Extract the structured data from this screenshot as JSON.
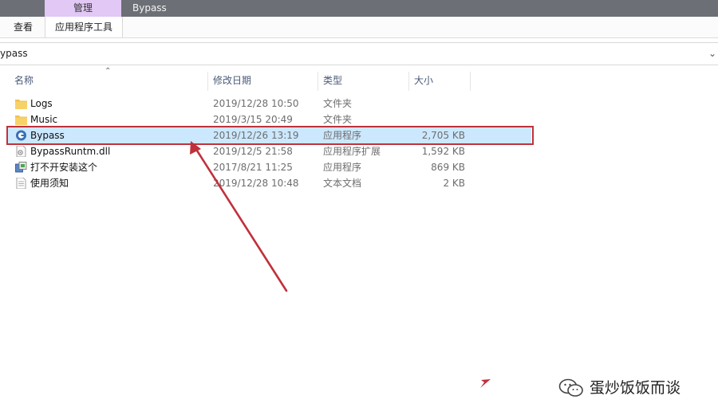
{
  "ribbon": {
    "context_tab": "管理",
    "window_title": "Bypass",
    "tabs": [
      "查看",
      "应用程序工具"
    ]
  },
  "address_bar": {
    "path": "ypass",
    "chevron": "⌄"
  },
  "columns": {
    "name": "名称",
    "date": "修改日期",
    "type": "类型",
    "size": "大小"
  },
  "files": [
    {
      "name": "Logs",
      "date": "2019/12/28 10:50",
      "type": "文件夹",
      "size": "",
      "icon": "folder-icon"
    },
    {
      "name": "Music",
      "date": "2019/3/15 20:49",
      "type": "文件夹",
      "size": "",
      "icon": "folder-icon"
    },
    {
      "name": "Bypass",
      "date": "2019/12/26 13:19",
      "type": "应用程序",
      "size": "2,705 KB",
      "icon": "app-icon",
      "selected": true
    },
    {
      "name": "BypassRuntm.dll",
      "date": "2019/12/5 21:58",
      "type": "应用程序扩展",
      "size": "1,592 KB",
      "icon": "dll-icon"
    },
    {
      "name": "打不开安装这个",
      "date": "2017/8/21 11:25",
      "type": "应用程序",
      "size": "869 KB",
      "icon": "installer-icon"
    },
    {
      "name": "使用须知",
      "date": "2019/12/28 10:48",
      "type": "文本文档",
      "size": "2 KB",
      "icon": "text-file-icon"
    }
  ],
  "watermark": {
    "text": "蛋炒饭饭而谈",
    "icon": "wechat-icon"
  },
  "colors": {
    "selection": "#cce8ff",
    "highlight": "#c0313b",
    "context_tab": "#e2c8f5",
    "title_strip": "#6c6f76"
  }
}
